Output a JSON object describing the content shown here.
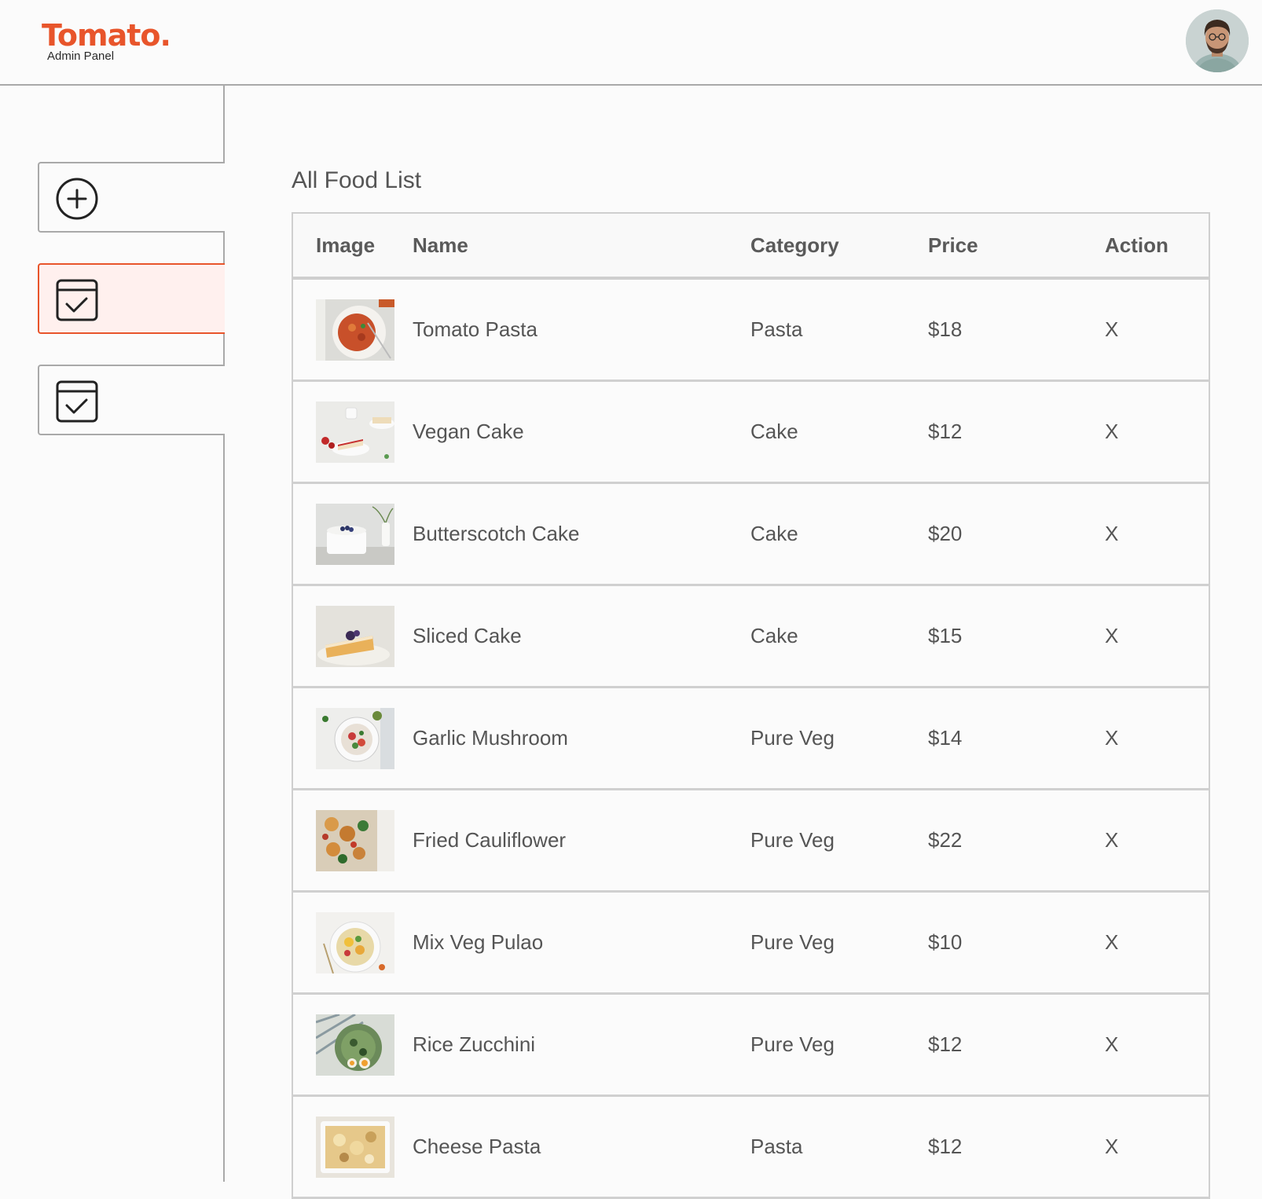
{
  "brand": {
    "name": "Tomato.",
    "subtitle": "Admin Panel",
    "accent": "#e8552b"
  },
  "header": {
    "avatar": "profile-avatar"
  },
  "sidebar": {
    "items": [
      {
        "icon": "add-circle-icon",
        "label": "",
        "active": false
      },
      {
        "icon": "calendar-check-icon",
        "label": "",
        "active": true
      },
      {
        "icon": "calendar-check-icon",
        "label": "",
        "active": false
      }
    ]
  },
  "main": {
    "title": "All Food List",
    "columns": [
      "Image",
      "Name",
      "Category",
      "Price",
      "Action"
    ],
    "rows": [
      {
        "name": "Tomato Pasta",
        "category": "Pasta",
        "price": "$18",
        "action": "X",
        "image": "tomato-pasta-photo"
      },
      {
        "name": "Vegan Cake",
        "category": "Cake",
        "price": "$12",
        "action": "X",
        "image": "vegan-cake-photo"
      },
      {
        "name": "Butterscotch Cake",
        "category": "Cake",
        "price": "$20",
        "action": "X",
        "image": "butterscotch-cake-photo"
      },
      {
        "name": "Sliced Cake",
        "category": "Cake",
        "price": "$15",
        "action": "X",
        "image": "sliced-cake-photo"
      },
      {
        "name": "Garlic Mushroom",
        "category": "Pure Veg",
        "price": "$14",
        "action": "X",
        "image": "garlic-mushroom-photo"
      },
      {
        "name": "Fried Cauliflower",
        "category": "Pure Veg",
        "price": "$22",
        "action": "X",
        "image": "fried-cauliflower-photo"
      },
      {
        "name": "Mix Veg Pulao",
        "category": "Pure Veg",
        "price": "$10",
        "action": "X",
        "image": "mix-veg-pulao-photo"
      },
      {
        "name": "Rice Zucchini",
        "category": "Pure Veg",
        "price": "$12",
        "action": "X",
        "image": "rice-zucchini-photo"
      },
      {
        "name": "Cheese Pasta",
        "category": "Pasta",
        "price": "$12",
        "action": "X",
        "image": "cheese-pasta-photo"
      }
    ]
  }
}
